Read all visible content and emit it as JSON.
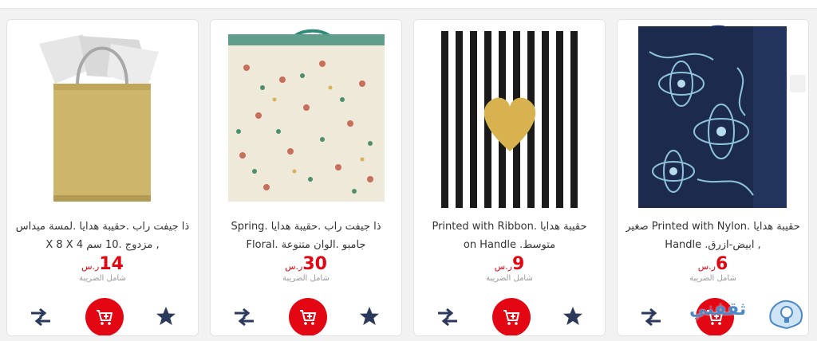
{
  "products": [
    {
      "title": "ذا جيفت راب .حقيبة هدايا .لمسة ميداس , مزدوج .10 سم 4 X 8 X",
      "price": "14",
      "currency": "ر.س",
      "tax_note": "شامل الضريبة"
    },
    {
      "title": "ذا جيفت راب .حقيبة هدايا .Spring جامبو .الوان متنوعة .Floral",
      "price": "30",
      "currency": "ر.س",
      "tax_note": "شامل الضريبة"
    },
    {
      "title": "حقيبة هدايا .Printed with Ribbon متوسط. on Handle",
      "price": "9",
      "currency": "ر.س",
      "tax_note": "شامل الضريبة"
    },
    {
      "title": "حقيبة هدايا .Printed with Nylon صغير , ابيض-ازرق. Handle",
      "price": "6",
      "currency": "ر.س",
      "tax_note": "شامل الضريبة"
    }
  ],
  "icons": {
    "compare": "compare-arrows-icon",
    "cart": "add-to-cart-icon",
    "wishlist": "star-icon"
  },
  "colors": {
    "accent": "#e30613",
    "icon": "#2b3a5c"
  },
  "watermark": {
    "text": "ثقفني"
  }
}
